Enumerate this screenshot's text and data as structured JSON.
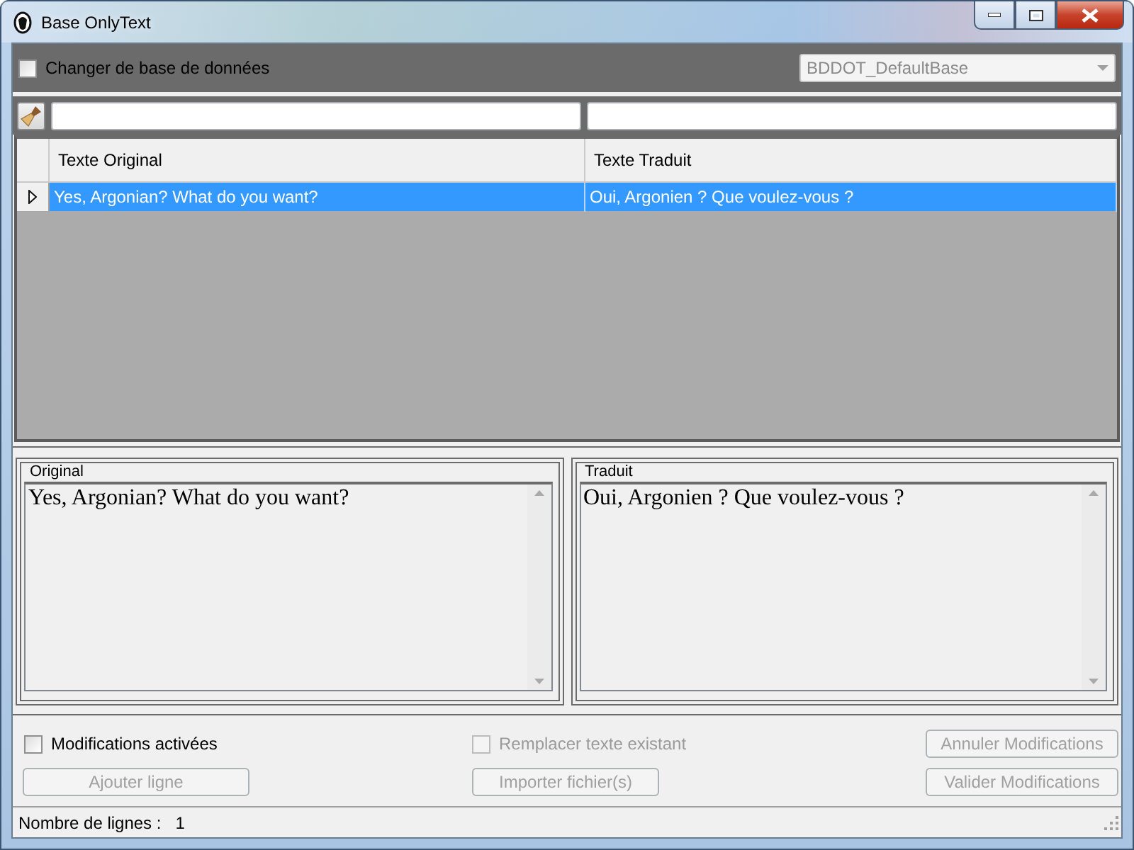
{
  "window": {
    "title": "Base OnlyText"
  },
  "toolbar": {
    "change_database": {
      "label": "Changer de base de données",
      "checked": false
    },
    "database": {
      "value": "BDDOT_DefaultBase",
      "disabled": true
    }
  },
  "table": {
    "columns": [
      "Texte Original",
      "Texte Traduit"
    ],
    "rows": [
      {
        "cells": [
          "Yes, Argonian? What do you want?",
          "Oui, Argonien ? Que voulez-vous ?"
        ],
        "selected": true
      }
    ]
  },
  "panels": [
    {
      "title": "Original",
      "text": "Yes, Argonian? What do you want?"
    },
    {
      "title": "Traduit",
      "text": "Oui, Argonien ? Que voulez-vous ?"
    }
  ],
  "options": [
    {
      "label": "Modifications activées",
      "checked": false,
      "disabled": false
    },
    {
      "label": "Remplacer texte existant",
      "checked": false,
      "disabled": true
    }
  ],
  "buttons": [
    {
      "label": "Ajouter ligne",
      "disabled": true
    },
    {
      "label": "Importer fichier(s)",
      "disabled": true
    },
    {
      "label": "Annuler Modifications",
      "disabled": true
    },
    {
      "label": "Valider Modifications",
      "disabled": true
    }
  ],
  "status_bar": {
    "label": "Nombre de lignes :",
    "value": "1"
  }
}
